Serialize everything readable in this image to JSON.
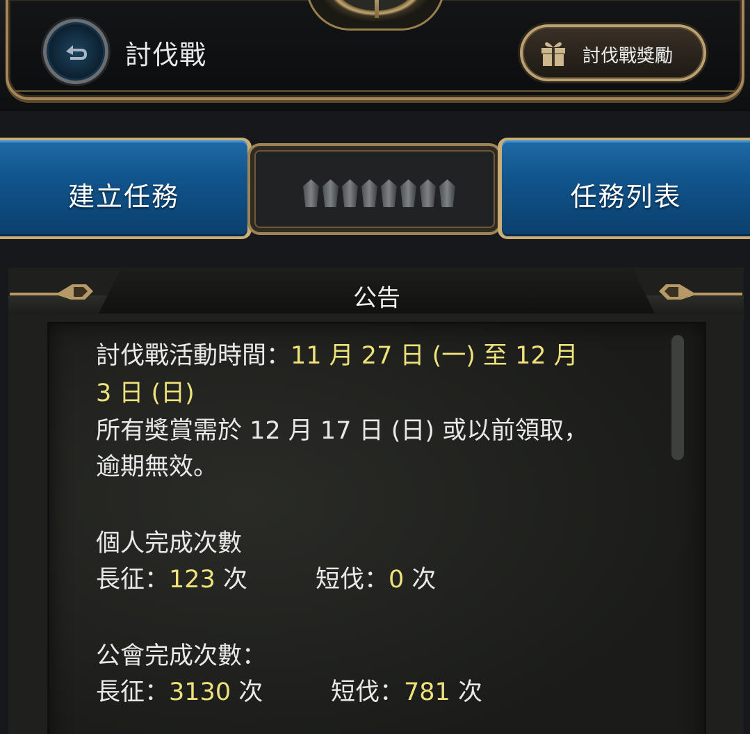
{
  "header": {
    "title": "討伐戰",
    "reward_button_label": "討伐戰獎勵"
  },
  "tabs": {
    "create_label": "建立任務",
    "list_label": "任務列表",
    "progress_total": 8,
    "progress_filled": 0
  },
  "notice": {
    "title": "公告",
    "event_time_label": "討伐戰活動時間：",
    "event_time_value_line1": "11 月 27 日 (一) 至 12 月",
    "event_time_value_line2": "3 日 (日)",
    "claim_line1": "所有獎賞需於 12 月 17 日 (日) 或以前領取，",
    "claim_line2": "逾期無效。",
    "personal_heading": "個人完成次數",
    "personal_long_label": "長征：",
    "personal_long_value": "123",
    "personal_short_label": "短伐：",
    "personal_short_value": "0",
    "times_unit": " 次",
    "guild_heading": "公會完成次數：",
    "guild_long_label": "長征：",
    "guild_long_value": "3130",
    "guild_short_label": "短伐：",
    "guild_short_value": "781"
  },
  "colors": {
    "accent_gold": "#c9ae77",
    "tab_blue": "#11548c",
    "highlight_yellow": "#f0e27a"
  },
  "icons": {
    "back": "back-arrow-icon",
    "gift": "gift-icon",
    "crystal": "crystal-icon"
  }
}
